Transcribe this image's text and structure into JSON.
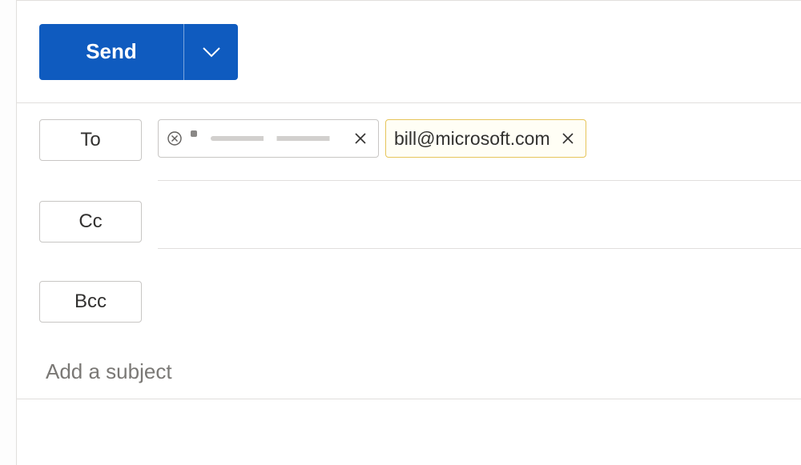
{
  "send": {
    "label": "Send"
  },
  "fields": {
    "to_label": "To",
    "cc_label": "Cc",
    "bcc_label": "Bcc"
  },
  "recipients": {
    "to": [
      {
        "email": "",
        "redacted": true,
        "invalid": true,
        "highlight": false
      },
      {
        "email": "bill@microsoft.com",
        "redacted": false,
        "invalid": false,
        "highlight": true
      }
    ]
  },
  "subject": {
    "placeholder": "Add a subject",
    "value": ""
  }
}
